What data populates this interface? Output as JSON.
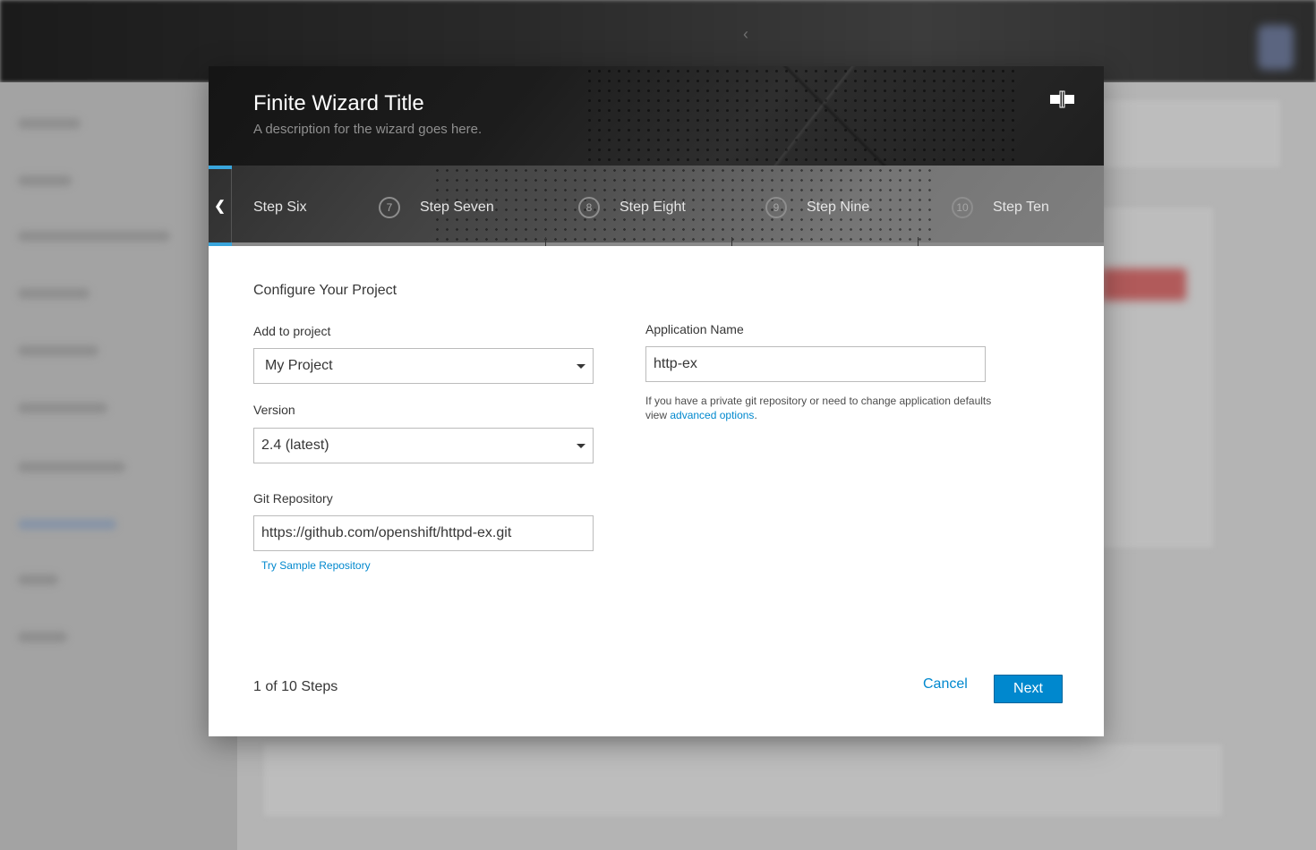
{
  "wizard": {
    "title": "Finite Wizard Title",
    "description": "A description for the wizard goes here."
  },
  "steps": {
    "items": [
      {
        "number": "",
        "label": "Step Six"
      },
      {
        "number": "7",
        "label": "Step Seven"
      },
      {
        "number": "8",
        "label": "Step Eight"
      },
      {
        "number": "9",
        "label": "Step Nine"
      },
      {
        "number": "10",
        "label": "Step Ten"
      }
    ]
  },
  "form": {
    "section_title": "Configure Your Project",
    "project_label": "Add to project",
    "project_value": "My Project",
    "version_label": "Version",
    "version_value": "2.4 (latest)",
    "git_label": "Git Repository",
    "git_value": "https://github.com/openshift/httpd-ex.git",
    "sample_link": "Try Sample Repository",
    "app_name_label": "Application Name",
    "app_name_value": "http-ex",
    "help_text": "If you have a private git repository or need to change application defaults view",
    "help_link": "advanced options",
    "help_suffix": "."
  },
  "footer": {
    "progress": "1 of 10 Steps",
    "cancel_label": "Cancel",
    "next_label": "Next"
  },
  "colors": {
    "accent": "#39a5dc",
    "link": "#0088ce",
    "primary_button": "#0088ce"
  }
}
